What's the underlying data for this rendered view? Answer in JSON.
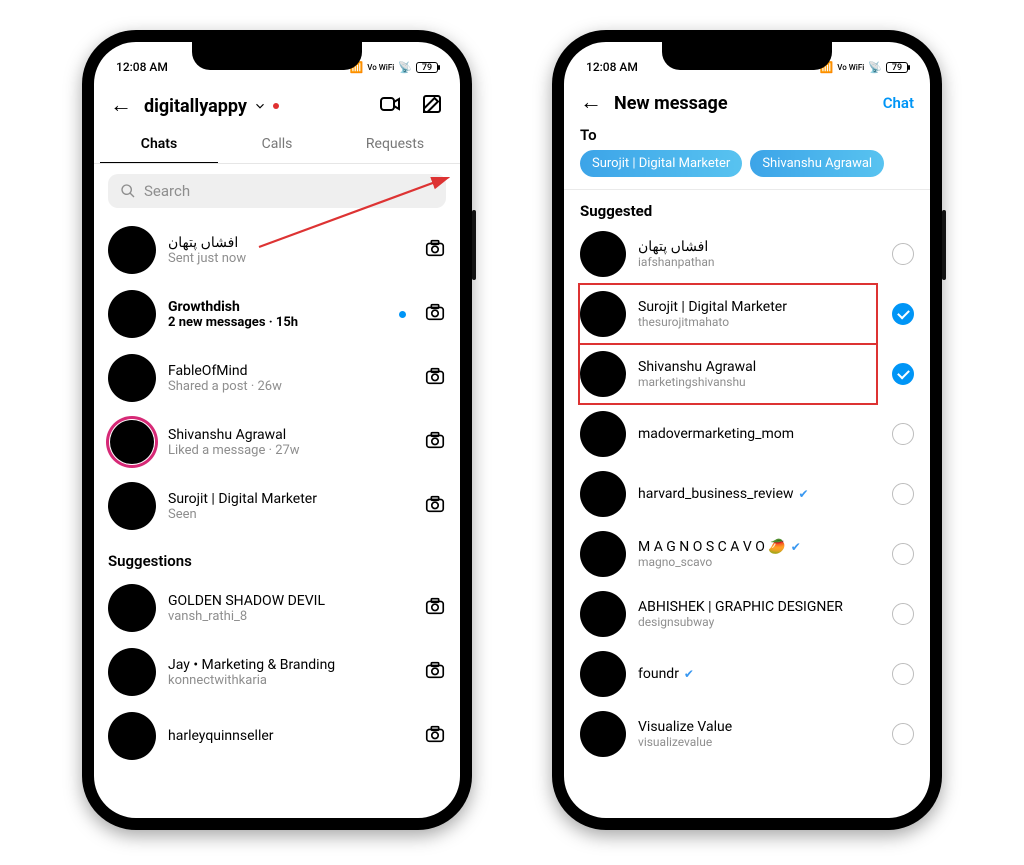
{
  "status": {
    "time": "12:08 AM",
    "wifi_label": "Vo WiFi",
    "battery": "79"
  },
  "phone1": {
    "username": "digitallyappy",
    "tabs": {
      "chats": "Chats",
      "calls": "Calls",
      "requests": "Requests"
    },
    "search_placeholder": "Search",
    "chats": [
      {
        "title": "افشاں پتھان",
        "sub": "Sent just now",
        "unread": false
      },
      {
        "title": "Growthdish",
        "sub": "2 new messages · 15h",
        "unread": true
      },
      {
        "title": "FableOfMind",
        "sub": "Shared a post · 26w",
        "unread": false
      },
      {
        "title": "Shivanshu Agrawal",
        "sub": "Liked a message · 27w",
        "unread": false,
        "story": true
      },
      {
        "title": "Surojit | Digital Marketer",
        "sub": "Seen",
        "unread": false
      }
    ],
    "suggestions_label": "Suggestions",
    "suggestions": [
      {
        "title": "GOLDEN SHADOW DEVIL",
        "sub": "vansh_rathi_8"
      },
      {
        "title": "Jay • Marketing & Branding",
        "sub": "konnectwithkaria"
      },
      {
        "title": "harleyquinnseller",
        "sub": ""
      }
    ]
  },
  "phone2": {
    "header_title": "New message",
    "chat_button": "Chat",
    "to_label": "To",
    "selected_chips": [
      "Surojit | Digital Marketer",
      "Shivanshu Agrawal"
    ],
    "suggested_label": "Suggested",
    "suggested": [
      {
        "name": "افشاں پتھان",
        "handle": "iafshanpathan",
        "checked": false,
        "highlight": false
      },
      {
        "name": "Surojit | Digital Marketer",
        "handle": "thesurojitmahato",
        "checked": true,
        "highlight": true
      },
      {
        "name": "Shivanshu Agrawal",
        "handle": "marketingshivanshu",
        "checked": true,
        "highlight": true
      },
      {
        "name": "madovermarketing_mom",
        "handle": "",
        "checked": false
      },
      {
        "name": "harvard_business_review",
        "handle": "",
        "checked": false,
        "verified": true
      },
      {
        "name": "M A G N O  S C A V O 🥭",
        "handle": "magno_scavo",
        "checked": false,
        "verified": true
      },
      {
        "name": "ABHISHEK | GRAPHIC DESIGNER",
        "handle": "designsubway",
        "checked": false
      },
      {
        "name": "foundr",
        "handle": "",
        "checked": false,
        "verified": true
      },
      {
        "name": "Visualize Value",
        "handle": "visualizevalue",
        "checked": false
      }
    ]
  }
}
